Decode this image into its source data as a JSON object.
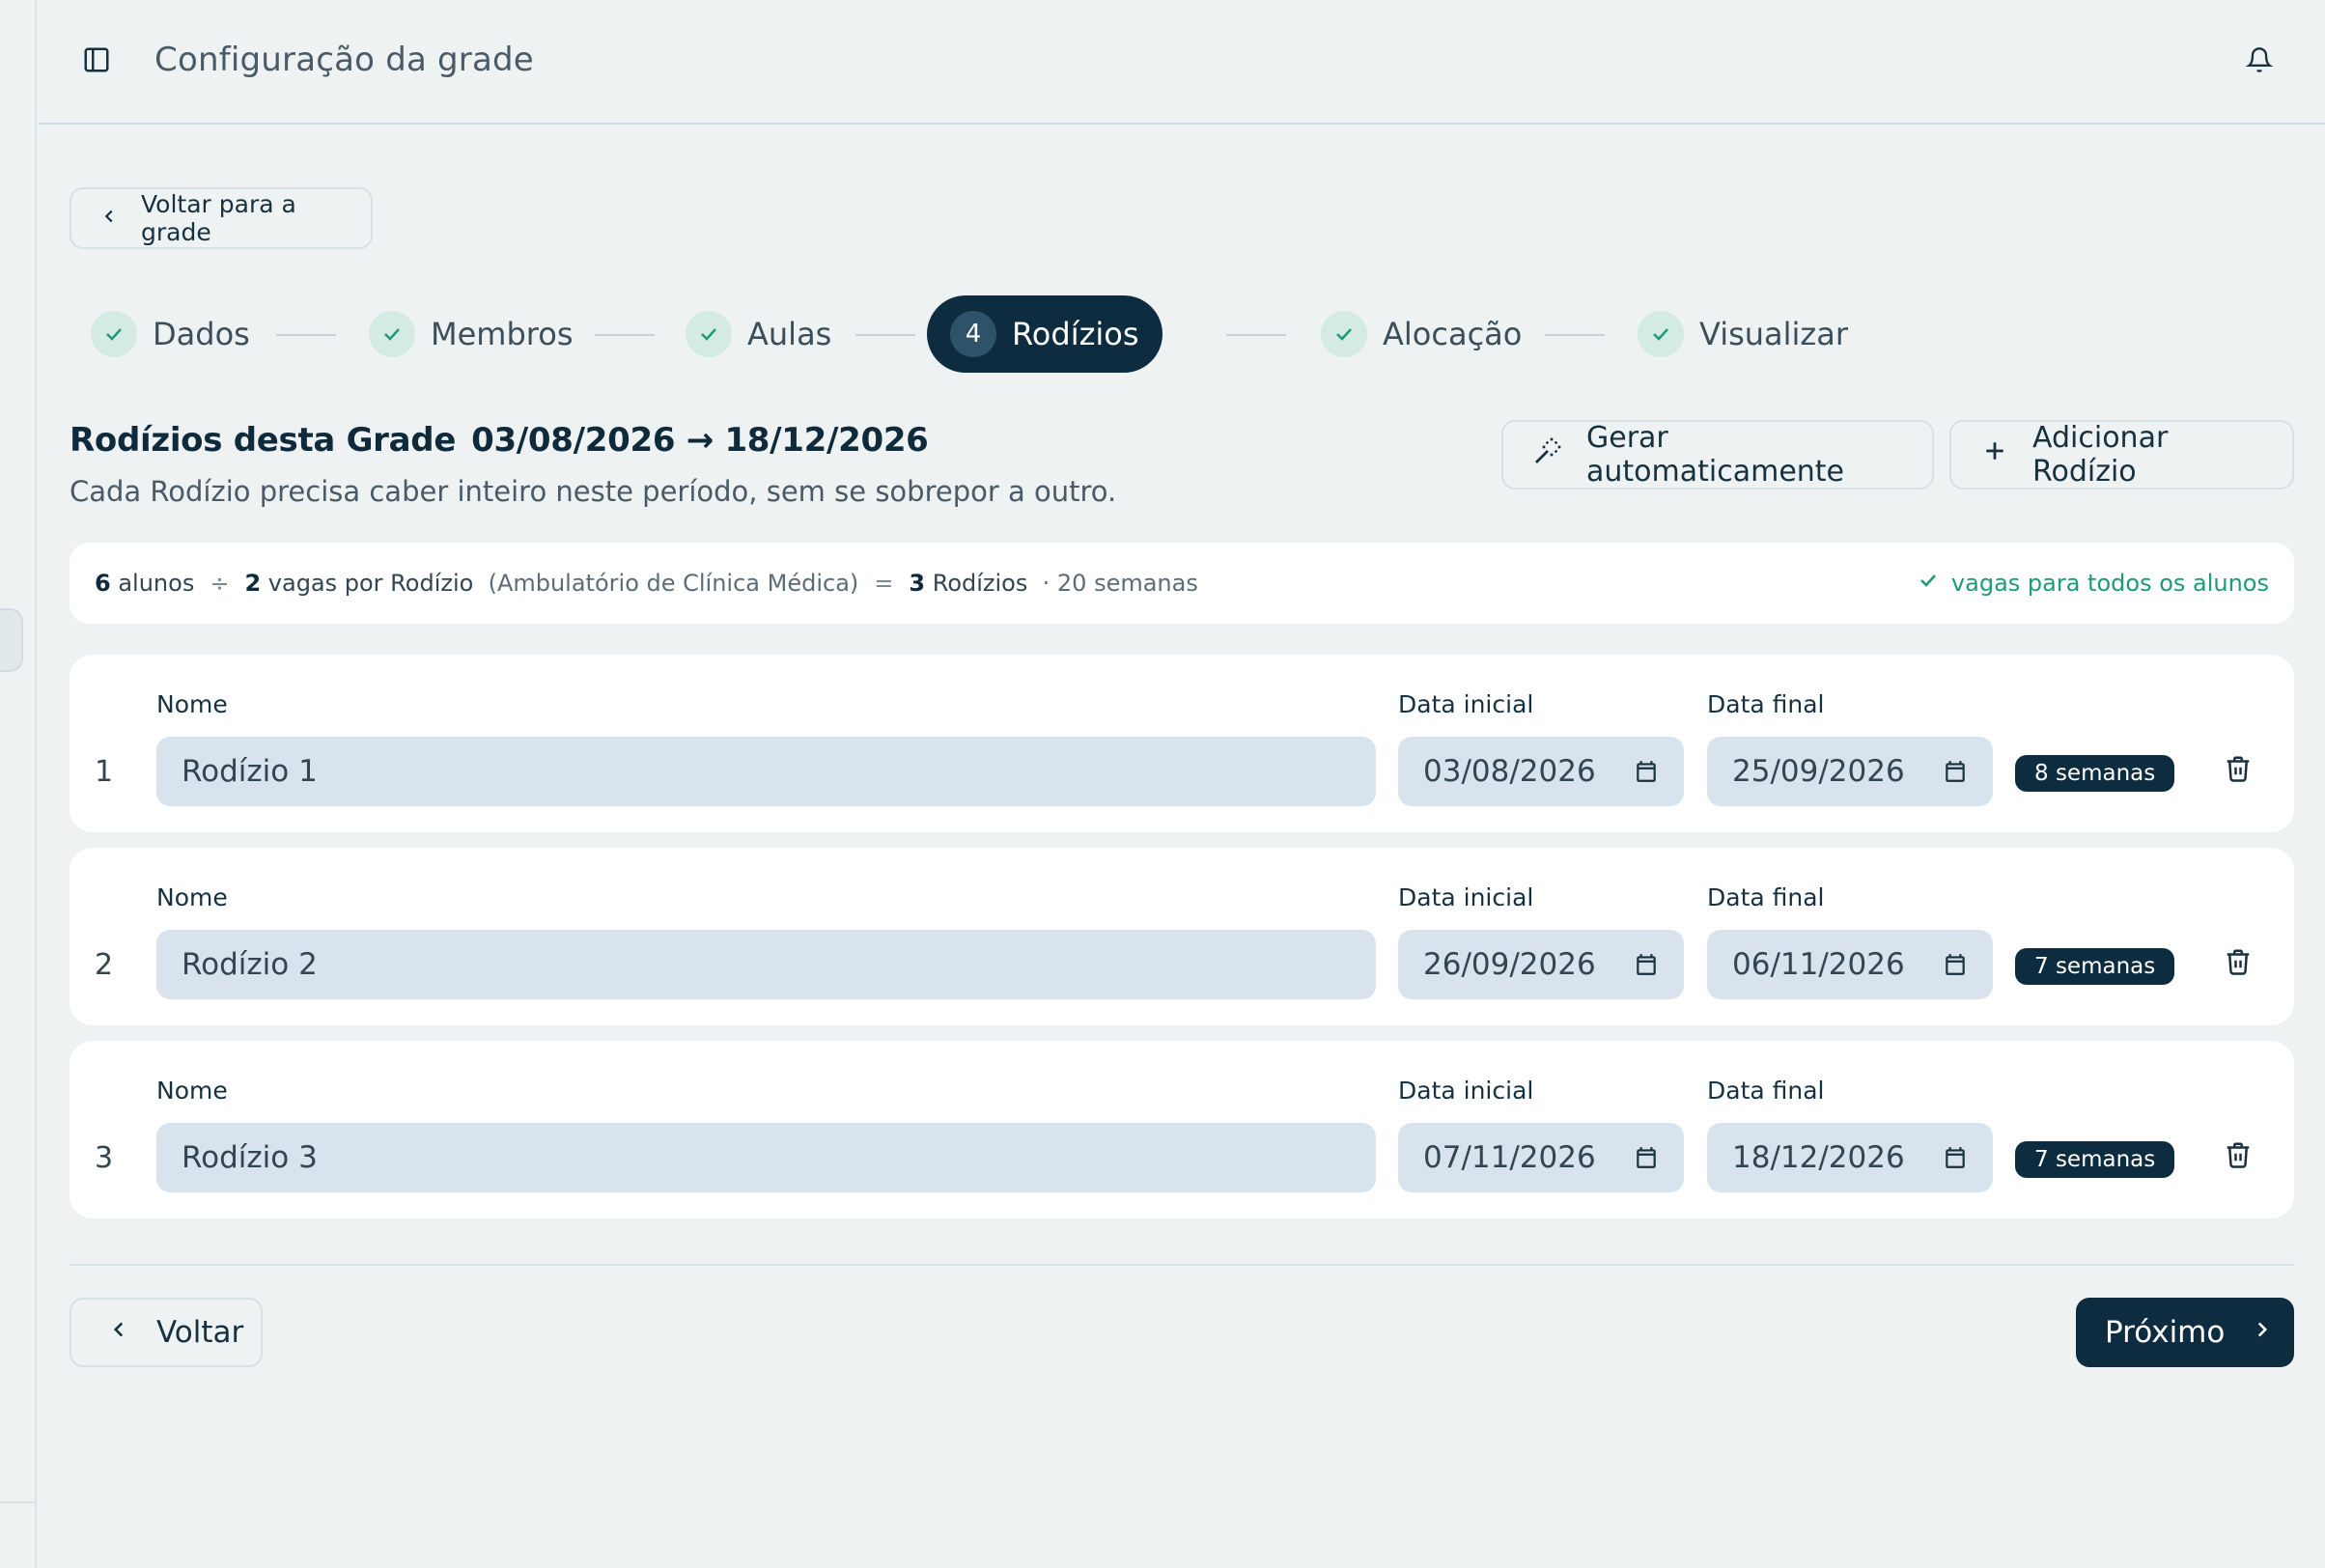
{
  "header": {
    "title": "Configuração da grade"
  },
  "back_link": {
    "label": "Voltar para a grade"
  },
  "stepper": {
    "steps": [
      {
        "label": "Dados",
        "state": "done"
      },
      {
        "label": "Membros",
        "state": "done"
      },
      {
        "label": "Aulas",
        "state": "done"
      },
      {
        "label": "Rodízios",
        "state": "active",
        "number": "4"
      },
      {
        "label": "Alocação",
        "state": "done"
      },
      {
        "label": "Visualizar",
        "state": "done"
      }
    ]
  },
  "section": {
    "title": "Rodízios desta Grade",
    "range": "03/08/2026 → 18/12/2026",
    "subtitle": "Cada Rodízio precisa caber inteiro neste período, sem se sobrepor a outro.",
    "auto_button": "Gerar automaticamente",
    "add_button": "Adicionar Rodízio"
  },
  "summary": {
    "students_count": "6",
    "students_label": "alunos",
    "div_op": "÷",
    "slots_count": "2",
    "slots_label": "vagas por Rodízio",
    "context": "(Ambulatório de Clínica Médica)",
    "eq_op": "=",
    "rotations_count": "3",
    "rotations_label": "Rodízios",
    "weeks_total": "· 20 semanas",
    "status": "vagas para todos os alunos"
  },
  "labels": {
    "name": "Nome",
    "start": "Data inicial",
    "end": "Data final"
  },
  "rotations": [
    {
      "index": "1",
      "name": "Rodízio 1",
      "start": "03/08/2026",
      "end": "25/09/2026",
      "weeks": "8 semanas"
    },
    {
      "index": "2",
      "name": "Rodízio 2",
      "start": "26/09/2026",
      "end": "06/11/2026",
      "weeks": "7 semanas"
    },
    {
      "index": "3",
      "name": "Rodízio 3",
      "start": "07/11/2026",
      "end": "18/12/2026",
      "weeks": "7 semanas"
    }
  ],
  "footer": {
    "back_label": "Voltar",
    "next_label": "Próximo"
  },
  "colors": {
    "primary": "#0d2c40",
    "success": "#1f9a78",
    "field_bg": "#d9e3ee",
    "page_bg": "#eef2f2"
  },
  "icons": [
    "sidebar-toggle-icon",
    "bell-icon",
    "chevron-left-icon",
    "check-icon",
    "magic-wand-icon",
    "plus-icon",
    "calendar-icon",
    "trash-icon",
    "chevron-right-icon"
  ]
}
